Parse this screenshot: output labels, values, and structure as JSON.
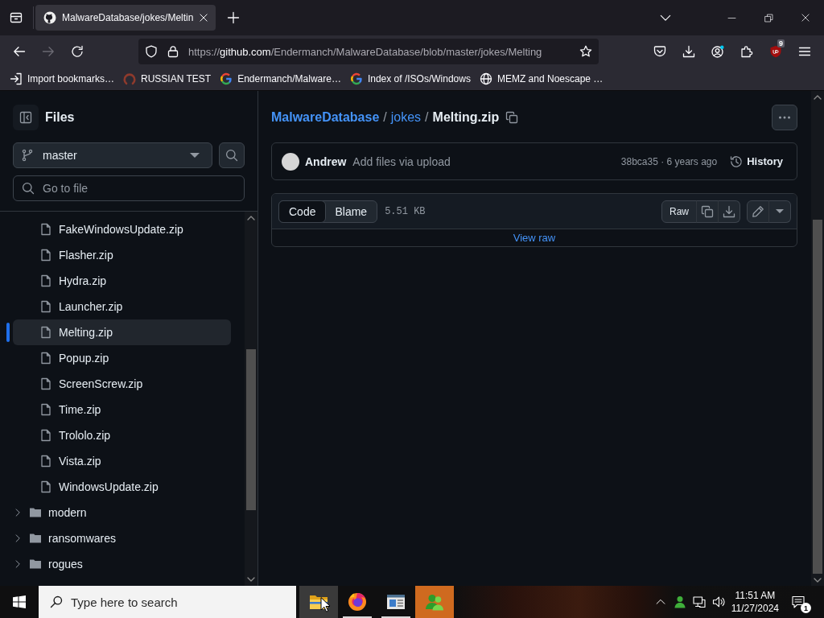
{
  "browser": {
    "tab": {
      "title": "MalwareDatabase/jokes/Meltin",
      "selected": true
    },
    "nav_buttons": [
      {
        "kind": "back",
        "disabled": false
      },
      {
        "kind": "forward",
        "disabled": true
      },
      {
        "kind": "reload",
        "disabled": false
      }
    ],
    "url": {
      "scheme": "https://",
      "host": "github.com",
      "path": "/Endermanch/MalwareDatabase/blob/master/jokes/Melting"
    },
    "toolbar": [
      {
        "kind": "pocket"
      },
      {
        "kind": "download"
      },
      {
        "kind": "account"
      },
      {
        "kind": "extensions"
      },
      {
        "kind": "blocker",
        "badge": "9"
      },
      {
        "kind": "menu"
      }
    ],
    "bookmarks": [
      {
        "kind": "import",
        "label": "Import bookmarks…"
      },
      {
        "kind": "ring",
        "label": "RUSSIAN TEST"
      },
      {
        "kind": "g",
        "label": "Endermanch/Malware…"
      },
      {
        "kind": "g",
        "label": "Index of /ISOs/Windows"
      },
      {
        "kind": "globe",
        "label": "MEMZ and Noescape …"
      }
    ]
  },
  "sidebar": {
    "title": "Files",
    "branch": "master",
    "file_search": {
      "placeholder": "Go to file"
    },
    "tree": {
      "files": [
        {
          "name": "FakeWindowsUpdate.zip",
          "selected": false
        },
        {
          "name": "Flasher.zip",
          "selected": false
        },
        {
          "name": "Hydra.zip",
          "selected": false
        },
        {
          "name": "Launcher.zip",
          "selected": false
        },
        {
          "name": "Melting.zip",
          "selected": true
        },
        {
          "name": "Popup.zip",
          "selected": false
        },
        {
          "name": "ScreenScrew.zip",
          "selected": false
        },
        {
          "name": "Time.zip",
          "selected": false
        },
        {
          "name": "Trololo.zip",
          "selected": false
        },
        {
          "name": "Vista.zip",
          "selected": false
        },
        {
          "name": "WindowsUpdate.zip",
          "selected": false
        }
      ],
      "folders": [
        {
          "name": "modern",
          "expanded": false
        },
        {
          "name": "ransomwares",
          "expanded": false
        },
        {
          "name": "rogues",
          "expanded": false
        }
      ]
    }
  },
  "file": {
    "breadcrumb": [
      {
        "kind": "repo",
        "text": "MalwareDatabase"
      },
      {
        "kind": "separator",
        "text": "/"
      },
      {
        "kind": "link",
        "text": "jokes"
      },
      {
        "kind": "separator",
        "text": "/"
      },
      {
        "kind": "current",
        "text": "Melting.zip"
      }
    ],
    "commit": {
      "author": "Andrew",
      "message": "Add files via upload",
      "sha_age": "38bca35 · 6 years ago",
      "history": "History"
    },
    "view_tabs": [
      {
        "label": "Code",
        "selected": true
      },
      {
        "label": "Blame",
        "selected": false
      }
    ],
    "size": "5.51 KB",
    "raw": "Raw",
    "view_raw": "View raw"
  },
  "taskbar": {
    "search": {
      "placeholder": "Type here to search"
    },
    "apps": [
      {
        "kind": "explorer",
        "running": false,
        "hovered": true,
        "flashing": false
      },
      {
        "kind": "firefox",
        "running": true,
        "hovered": false,
        "flashing": false
      },
      {
        "kind": "window",
        "running": true,
        "hovered": false,
        "flashing": false
      },
      {
        "kind": "people",
        "running": false,
        "hovered": false,
        "flashing": true
      }
    ],
    "time": "11:51 AM",
    "date": "11/27/2024",
    "notifications": "1"
  }
}
